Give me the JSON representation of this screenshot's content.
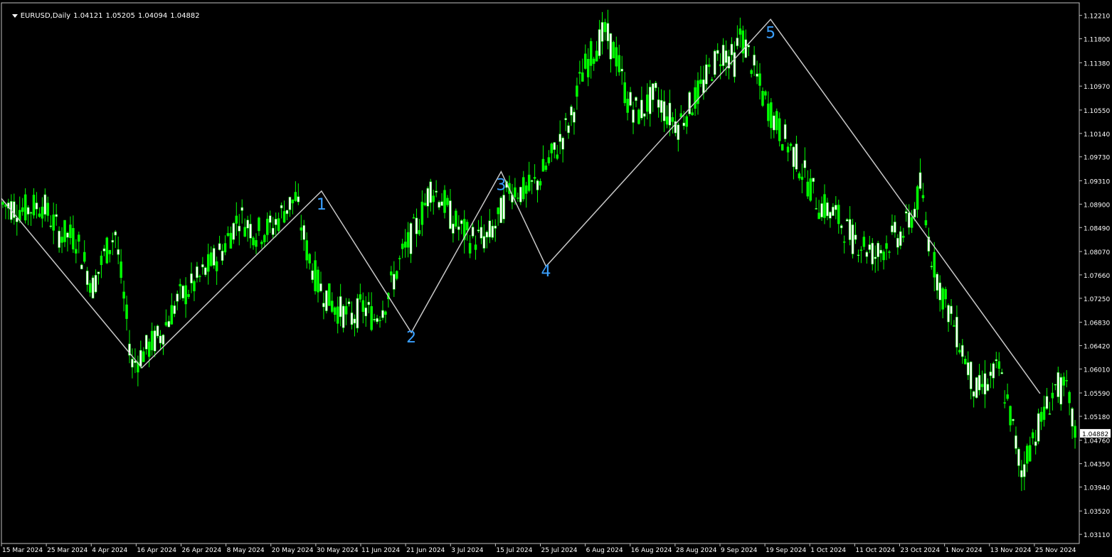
{
  "header": {
    "symbol": "EURUSD,Daily",
    "open": "1.04121",
    "high": "1.05205",
    "low": "1.04094",
    "close": "1.04882"
  },
  "colors": {
    "background": "#000000",
    "frame": "#c0c0c0",
    "candle": "#00ff00",
    "bull_body": "#00ff00",
    "bear_body": "#ffffff",
    "wave_line": "#c8c8c8",
    "wave_label": "#3aa0ff",
    "text": "#ffffff",
    "price_tag_bg": "#ffffff",
    "price_tag_text": "#000000"
  },
  "chart_data": {
    "type": "candlestick",
    "symbol": "EURUSD",
    "timeframe": "Daily",
    "x_tick_labels": [
      "15 Mar 2024",
      "25 Mar 2024",
      "4 Apr 2024",
      "16 Apr 2024",
      "26 Apr 2024",
      "8 May 2024",
      "20 May 2024",
      "30 May 2024",
      "11 Jun 2024",
      "21 Jun 2024",
      "3 Jul 2024",
      "15 Jul 2024",
      "25 Jul 2024",
      "6 Aug 2024",
      "16 Aug 2024",
      "28 Aug 2024",
      "9 Sep 2024",
      "19 Sep 2024",
      "1 Oct 2024",
      "11 Oct 2024",
      "23 Oct 2024",
      "1 Nov 2024",
      "13 Nov 2024",
      "25 Nov 2024"
    ],
    "y_tick_labels": [
      "1.12210",
      "1.11800",
      "1.11380",
      "1.10970",
      "1.10550",
      "1.10140",
      "1.09730",
      "1.09310",
      "1.08900",
      "1.08490",
      "1.08070",
      "1.07660",
      "1.07250",
      "1.06830",
      "1.06420",
      "1.06010",
      "1.05590",
      "1.05180",
      "1.04760",
      "1.04350",
      "1.03940",
      "1.03520",
      "1.03110"
    ],
    "ylim": [
      1.0295,
      1.1243
    ],
    "current_price": "1.04882",
    "wave_points": [
      {
        "label": "",
        "date": "15 Mar 2024",
        "price": 1.09
      },
      {
        "label": "",
        "date": "16 Apr 2024",
        "price": 1.0603
      },
      {
        "label": "1",
        "date": "30 May 2024",
        "price": 1.0913
      },
      {
        "label": "2",
        "date": "21 Jun 2024",
        "price": 1.0665
      },
      {
        "label": "3",
        "date": "15 Jul 2024",
        "price": 1.0947
      },
      {
        "label": "4",
        "date": "25 Jul 2024",
        "price": 1.0781
      },
      {
        "label": "5",
        "date": "19 Sep 2024",
        "price": 1.1214
      },
      {
        "label": "",
        "date": "25 Nov 2024",
        "price": 1.0558
      }
    ],
    "price_path": [
      [
        0,
        1.089
      ],
      [
        8,
        1.088
      ],
      [
        14,
        1.089
      ],
      [
        20,
        1.084
      ],
      [
        26,
        1.083
      ],
      [
        32,
        1.0745
      ],
      [
        36,
        1.08
      ],
      [
        40,
        1.084
      ],
      [
        46,
        1.061
      ],
      [
        48,
        1.062
      ],
      [
        52,
        1.064
      ],
      [
        56,
        1.066
      ],
      [
        62,
        1.072
      ],
      [
        70,
        1.076
      ],
      [
        78,
        1.081
      ],
      [
        84,
        1.087
      ],
      [
        90,
        1.084
      ],
      [
        96,
        1.085
      ],
      [
        100,
        1.088
      ],
      [
        104,
        1.09
      ],
      [
        108,
        1.081
      ],
      [
        112,
        1.075
      ],
      [
        118,
        1.071
      ],
      [
        124,
        1.069
      ],
      [
        128,
        1.071
      ],
      [
        132,
        1.069
      ],
      [
        136,
        1.072
      ],
      [
        142,
        1.08
      ],
      [
        148,
        1.086
      ],
      [
        152,
        1.092
      ],
      [
        156,
        1.09
      ],
      [
        160,
        1.086
      ],
      [
        166,
        1.083
      ],
      [
        172,
        1.083
      ],
      [
        176,
        1.086
      ],
      [
        180,
        1.092
      ],
      [
        186,
        1.091
      ],
      [
        190,
        1.093
      ],
      [
        196,
        1.098
      ],
      [
        202,
        1.104
      ],
      [
        206,
        1.112
      ],
      [
        210,
        1.116
      ],
      [
        214,
        1.119
      ],
      [
        218,
        1.115
      ],
      [
        222,
        1.107
      ],
      [
        226,
        1.105
      ],
      [
        232,
        1.108
      ],
      [
        236,
        1.105
      ],
      [
        240,
        1.103
      ],
      [
        244,
        1.106
      ],
      [
        248,
        1.109
      ],
      [
        252,
        1.113
      ],
      [
        256,
        1.116
      ],
      [
        260,
        1.114
      ],
      [
        262,
        1.119
      ],
      [
        266,
        1.114
      ],
      [
        270,
        1.108
      ],
      [
        276,
        1.102
      ],
      [
        282,
        1.097
      ],
      [
        286,
        1.093
      ],
      [
        290,
        1.089
      ],
      [
        296,
        1.087
      ],
      [
        302,
        1.083
      ],
      [
        306,
        1.082
      ],
      [
        310,
        1.08
      ],
      [
        316,
        1.083
      ],
      [
        320,
        1.084
      ],
      [
        324,
        1.088
      ],
      [
        326,
        1.092
      ],
      [
        330,
        1.08
      ],
      [
        334,
        1.073
      ],
      [
        338,
        1.068
      ],
      [
        342,
        1.062
      ],
      [
        346,
        1.056
      ],
      [
        350,
        1.058
      ],
      [
        354,
        1.06
      ],
      [
        358,
        1.052
      ],
      [
        362,
        1.042
      ],
      [
        366,
        1.048
      ],
      [
        370,
        1.052
      ],
      [
        374,
        1.057
      ],
      [
        378,
        1.056
      ],
      [
        381,
        1.0488
      ]
    ]
  }
}
